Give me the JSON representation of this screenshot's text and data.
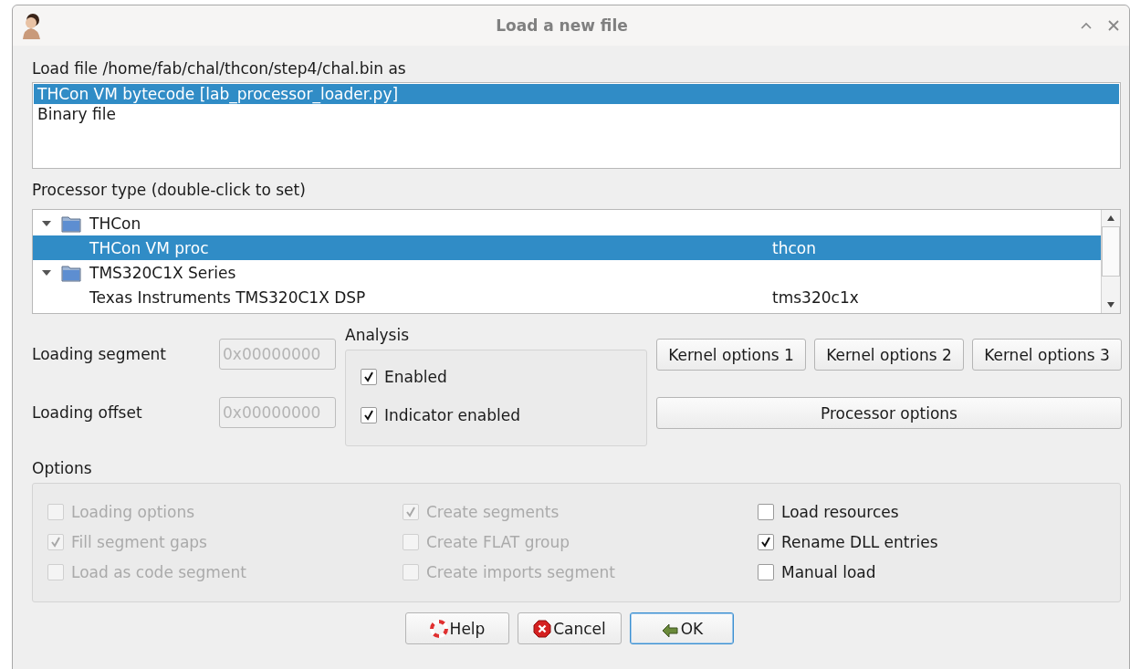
{
  "window": {
    "title": "Load a new file"
  },
  "loader": {
    "label": "Load file /home/fab/chal/thcon/step4/chal.bin as",
    "items": [
      {
        "label": "THCon VM bytecode [lab_processor_loader.py]",
        "selected": true
      },
      {
        "label": "Binary file",
        "selected": false
      }
    ]
  },
  "processor": {
    "label": "Processor type (double-click to set)",
    "tree": [
      {
        "label": "THCon",
        "expanded": true,
        "selected": false,
        "children": [
          {
            "label": "THCon VM proc",
            "module": "thcon",
            "selected": true
          }
        ]
      },
      {
        "label": "TMS320C1X Series",
        "expanded": true,
        "selected": false,
        "children": [
          {
            "label": "Texas Instruments TMS320C1X DSP",
            "module": "tms320c1x",
            "selected": false
          }
        ]
      }
    ]
  },
  "loading": [
    {
      "label": "Loading segment",
      "value": "0x00000000",
      "disabled": true
    },
    {
      "label": "Loading offset",
      "value": "0x00000000",
      "disabled": true
    }
  ],
  "analysis": {
    "title": "Analysis",
    "checkboxes": [
      {
        "label": "Enabled",
        "checked": true
      },
      {
        "label": "Indicator enabled",
        "checked": true
      }
    ]
  },
  "kernel_buttons": [
    "Kernel options 1",
    "Kernel options 2",
    "Kernel options 3"
  ],
  "processor_options_button": "Processor options",
  "options": {
    "title": "Options",
    "columns": [
      {
        "items": [
          {
            "label": "Loading options",
            "checked": false,
            "disabled": true
          },
          {
            "label": "Fill segment gaps",
            "checked": true,
            "disabled": true
          },
          {
            "label": "Load as code segment",
            "checked": false,
            "disabled": true
          }
        ]
      },
      {
        "items": [
          {
            "label": "Create segments",
            "checked": true,
            "disabled": true
          },
          {
            "label": "Create FLAT group",
            "checked": false,
            "disabled": true
          },
          {
            "label": "Create imports segment",
            "checked": false,
            "disabled": true
          }
        ]
      },
      {
        "items": [
          {
            "label": "Load resources",
            "checked": false,
            "disabled": false
          },
          {
            "label": "Rename DLL entries",
            "checked": true,
            "disabled": false
          },
          {
            "label": "Manual load",
            "checked": false,
            "disabled": false
          }
        ]
      }
    ]
  },
  "buttons": [
    {
      "label": "Help",
      "kind": "help",
      "focused": false
    },
    {
      "label": "Cancel",
      "kind": "cancel",
      "focused": false
    },
    {
      "label": "OK",
      "kind": "ok",
      "focused": true
    }
  ]
}
